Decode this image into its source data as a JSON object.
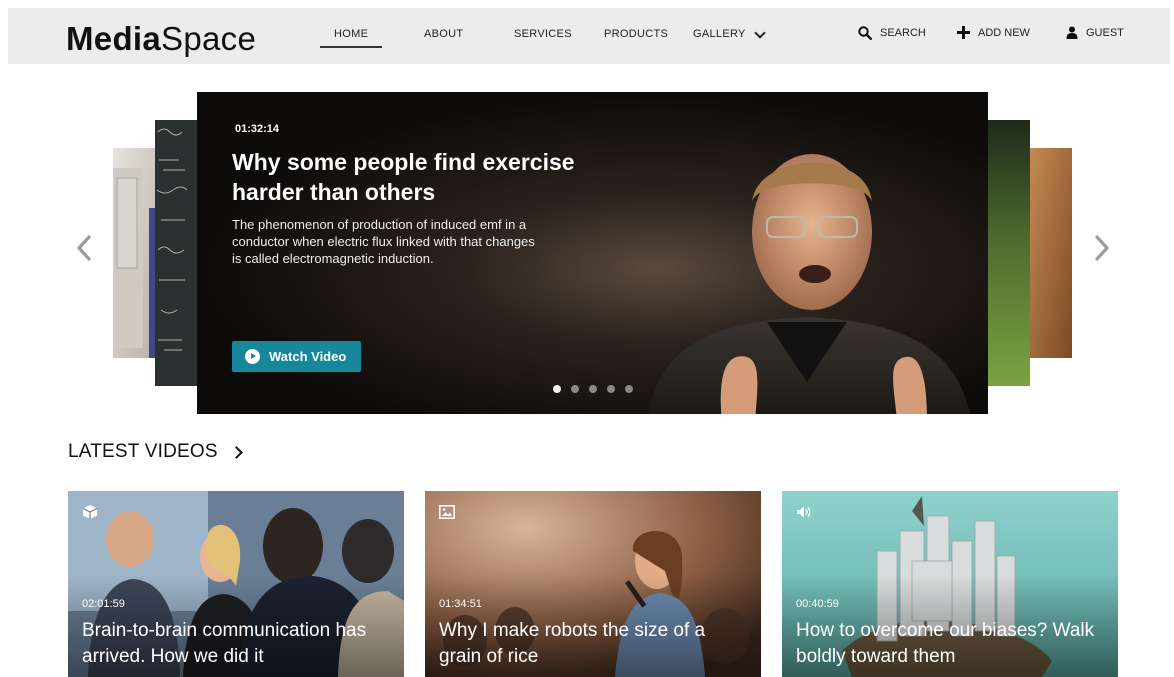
{
  "brand": {
    "bold": "Media",
    "light": "Space"
  },
  "nav": {
    "items": [
      {
        "label": "HOME"
      },
      {
        "label": "ABOUT"
      },
      {
        "label": "SERVICES"
      },
      {
        "label": "PRODUCTS"
      },
      {
        "label": "GALLERY"
      }
    ],
    "active": "HOME",
    "search_label": "SEARCH",
    "add_new_label": "ADD NEW",
    "guest_label": "GUEST"
  },
  "hero": {
    "duration": "01:32:14",
    "title": "Why some people find exercise harder than others",
    "description": "The phenomenon of production of induced emf in a conductor when electric flux linked with that changes is called electromagnetic induction.",
    "button_label": "Watch Video",
    "slide_count": 5,
    "active_slide": 1
  },
  "latest": {
    "heading": "LATEST VIDEOS",
    "items": [
      {
        "type_icon": "cube-icon",
        "duration": "02:01:59",
        "title": "Brain-to-brain communication has arrived. How we did it"
      },
      {
        "type_icon": "image-icon",
        "duration": "01:34:51",
        "title": "Why I make robots the size of a grain of rice"
      },
      {
        "type_icon": "audio-icon",
        "duration": "00:40:59",
        "title": "How to overcome our biases? Walk boldly toward them"
      }
    ]
  },
  "colors": {
    "accent": "#17879c",
    "nav_bg": "#ececec"
  }
}
